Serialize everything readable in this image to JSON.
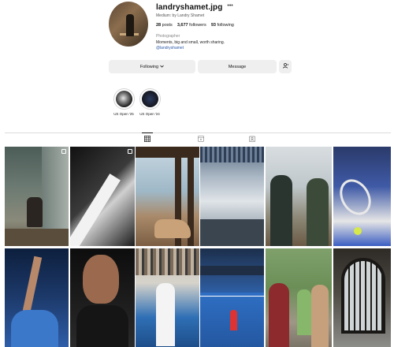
{
  "profile": {
    "username": "landryshamet.jpg",
    "more_icon": "ellipsis-icon",
    "subtitle": "Medium: by Landry Shamet",
    "stats": {
      "posts_count": "28",
      "posts_label": "posts",
      "followers_count": "3,677",
      "followers_label": "followers",
      "following_count": "93",
      "following_label": "following"
    },
    "category": "Photographer",
    "bio": "Moments, big and small, worth sharing.",
    "link": "@landryshamet"
  },
  "actions": {
    "following_label": "Following",
    "following_icon": "chevron-down-icon",
    "message_label": "Message",
    "add_user_icon": "add-user-icon"
  },
  "highlights": [
    {
      "label": "US Open '25"
    },
    {
      "label": "US Open '24"
    }
  ],
  "tabs": [
    {
      "name": "posts",
      "icon": "grid-icon",
      "active": true
    },
    {
      "name": "reels",
      "icon": "reels-icon",
      "active": false
    },
    {
      "name": "tagged",
      "icon": "tagged-icon",
      "active": false
    }
  ],
  "colors": {
    "button_bg": "#efefef",
    "link": "#2b5aa8",
    "divider": "#dbdbdb"
  }
}
